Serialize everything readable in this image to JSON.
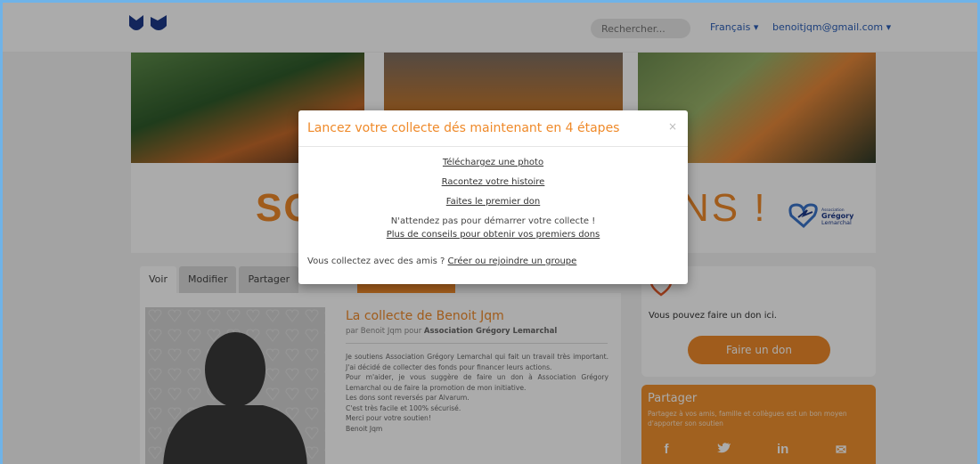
{
  "nav": {
    "search_placeholder": "Rechercher...",
    "language": "Français ▾",
    "user_email": "benoitjqm@gmail.com ▾"
  },
  "banner": {
    "slogan_left": "SO",
    "slogan_right": "NS !",
    "partner_logo_text": "Association Grégory Lemarchal"
  },
  "tabs": [
    {
      "label": "Voir"
    },
    {
      "label": "Modifier"
    },
    {
      "label": "Partager"
    }
  ],
  "collect": {
    "title": "La collecte de Benoit Jqm",
    "sub_prefix": "par Benoit Jqm pour ",
    "sub_assoc": "Association Grégory Lemarchal",
    "paragraphs": [
      "Je soutiens Association Grégory Lemarchal qui fait un travail très important. J'ai décidé de collecter des fonds pour financer leurs actions.",
      "Pour m'aider, je vous suggère de faire un don à Association Grégory Lemarchal ou de faire la promotion de mon initiative.",
      "Les dons sont reversés par Alvarum.",
      "C'est très facile et 100% sécurisé.",
      "Merci pour votre soutien!",
      "Benoit Jqm"
    ]
  },
  "donate": {
    "text": "Vous pouvez faire un don ici.",
    "button": "Faire un don"
  },
  "share": {
    "title": "Partager",
    "desc": "Partagez à vos amis, famille et collègues est un bon moyen d'apporter son soutien",
    "icons": [
      "f",
      "t",
      "in",
      "✉"
    ]
  },
  "modal": {
    "title": "Lancez votre collecte dés maintenant en 4 étapes",
    "close": "×",
    "link_photo": "Téléchargez une photo",
    "link_story": "Racontez votre histoire",
    "link_first_don": "Faites le premier don",
    "wait_text": "N'attendez pas pour démarrer votre collecte !",
    "link_tips": "Plus de conseils pour obtenir vos premiers dons",
    "footer_text": "Vous collectez avec des amis ? ",
    "footer_link": "Créer ou rejoindre un groupe"
  },
  "colors": {
    "accent": "#ef8a2a",
    "link_blue": "#2c5fb8",
    "logo_blue": "#1d3a8a"
  }
}
